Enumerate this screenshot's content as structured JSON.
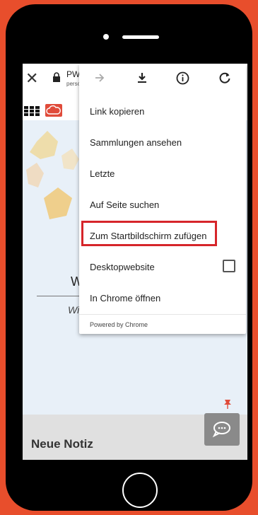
{
  "browser": {
    "title_partial": "PW",
    "subtitle_partial": "perso"
  },
  "menu": {
    "items": [
      {
        "label": "Link kopieren"
      },
      {
        "label": "Sammlungen ansehen"
      },
      {
        "label": "Letzte"
      },
      {
        "label": "Auf Seite suchen"
      },
      {
        "label": "Zum Startbildschirm zufügen",
        "highlighted": true
      },
      {
        "label": "Desktopwebsite",
        "checkbox": true,
        "checked": false
      },
      {
        "label": "In Chrome öffnen"
      }
    ],
    "footer": "Powered by Chrome",
    "top_icons": [
      "forward-arrow-icon",
      "download-icon",
      "info-icon",
      "refresh-icon"
    ]
  },
  "page": {
    "heading_partial": "W",
    "subheading_partial": "Wi",
    "note_bar_title": "Neue Notiz"
  },
  "colors": {
    "frame": "#e84e2c",
    "highlight": "#d6252a",
    "cloud_button": "#e04b3a"
  }
}
